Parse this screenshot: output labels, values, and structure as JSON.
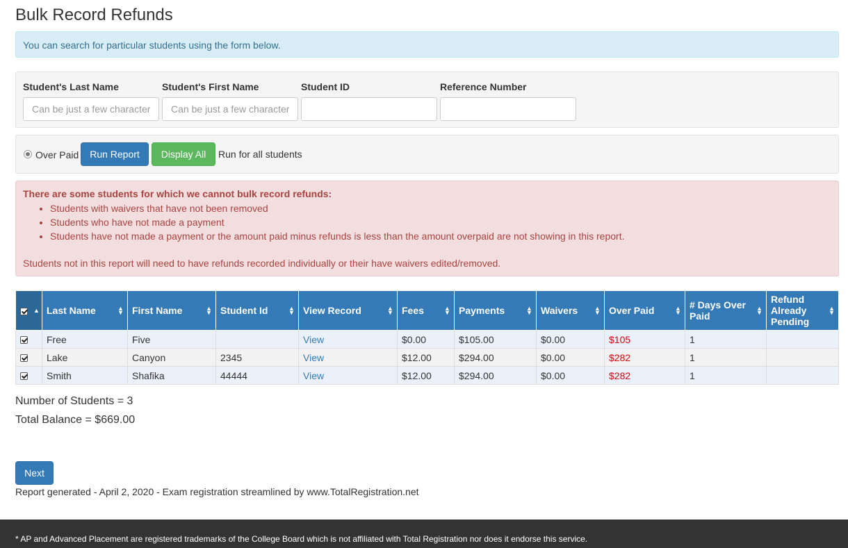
{
  "page": {
    "title": "Bulk Record Refunds"
  },
  "info_alert": "You can search for particular students using the form below.",
  "search": {
    "fields": [
      {
        "label": "Student's Last Name",
        "placeholder": "Can be just a few characters",
        "value": ""
      },
      {
        "label": "Student's First Name",
        "placeholder": "Can be just a few characters",
        "value": ""
      },
      {
        "label": "Student ID",
        "placeholder": "",
        "value": ""
      },
      {
        "label": "Reference Number",
        "placeholder": "",
        "value": ""
      }
    ]
  },
  "run": {
    "radio_label": "Over Paid",
    "run_report_label": "Run Report",
    "display_all_label": "Display All",
    "run_all_text": "Run for all students"
  },
  "warning": {
    "heading": "There are some students for which we cannot bulk record refunds:",
    "items": [
      "Students with waivers that have not been removed",
      "Students who have not made a payment",
      "Students have not made a payment or the amount paid minus refunds is less than the amount overpaid are not showing in this report."
    ],
    "footer": "Students not in this report will need to have refunds recorded individually or their have waivers edited/removed."
  },
  "table": {
    "headers": [
      "Last Name",
      "First Name",
      "Student Id",
      "View Record",
      "Fees",
      "Payments",
      "Waivers",
      "Over Paid",
      "# Days Over Paid",
      "Refund Already Pending"
    ],
    "rows": [
      {
        "last": "Free",
        "first": "Five",
        "id": "",
        "view": "View",
        "fees": "$0.00",
        "payments": "$105.00",
        "waivers": "$0.00",
        "overpaid": "$105",
        "days": "1",
        "pending": ""
      },
      {
        "last": "Lake",
        "first": "Canyon",
        "id": "2345",
        "view": "View",
        "fees": "$12.00",
        "payments": "$294.00",
        "waivers": "$0.00",
        "overpaid": "$282",
        "days": "1",
        "pending": ""
      },
      {
        "last": "Smith",
        "first": "Shafika",
        "id": "44444",
        "view": "View",
        "fees": "$12.00",
        "payments": "$294.00",
        "waivers": "$0.00",
        "overpaid": "$282",
        "days": "1",
        "pending": ""
      }
    ]
  },
  "summary": {
    "students": "Number of Students = 3",
    "balance": "Total Balance = $669.00"
  },
  "next_label": "Next",
  "report_footer": "Report generated - April 2, 2020 - Exam registration streamlined by www.TotalRegistration.net",
  "site_footer": "* AP and Advanced Placement are registered trademarks of the College Board which is not affiliated with Total Registration nor does it endorse this service.",
  "colors": {
    "primary": "#337ab7",
    "success": "#5cb85c",
    "danger_text": "#a94442",
    "overpaid_text": "#d9000d"
  }
}
